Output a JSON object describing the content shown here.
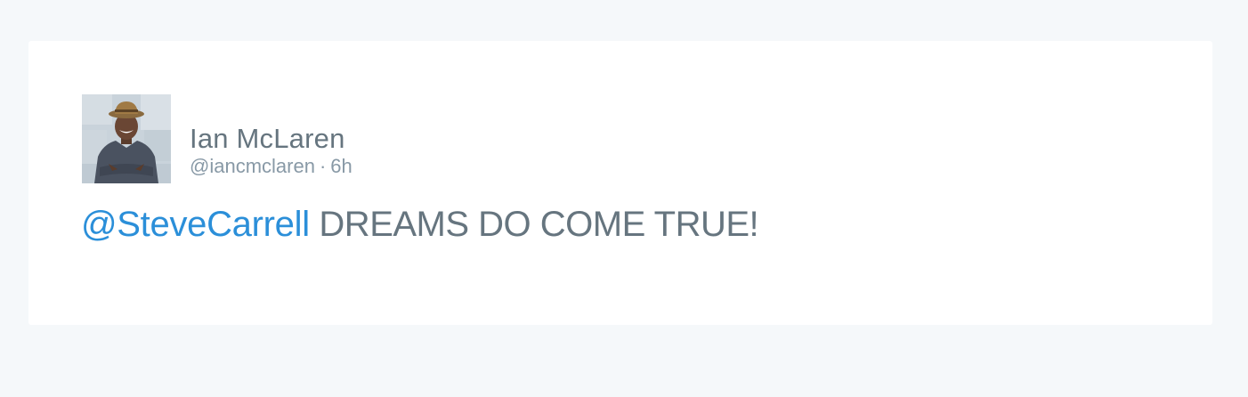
{
  "tweet": {
    "author": {
      "display_name": "Ian McLaren",
      "handle": "@iancmclaren",
      "separator": "·",
      "time_ago": "6h"
    },
    "mention": "@SteveCarrell",
    "text": "DREAMS DO COME TRUE!"
  },
  "colors": {
    "page_background": "#f5f8fa",
    "card_background": "#ffffff",
    "text": "#66757f",
    "muted": "#8899a6",
    "link": "#2b8fd9"
  }
}
